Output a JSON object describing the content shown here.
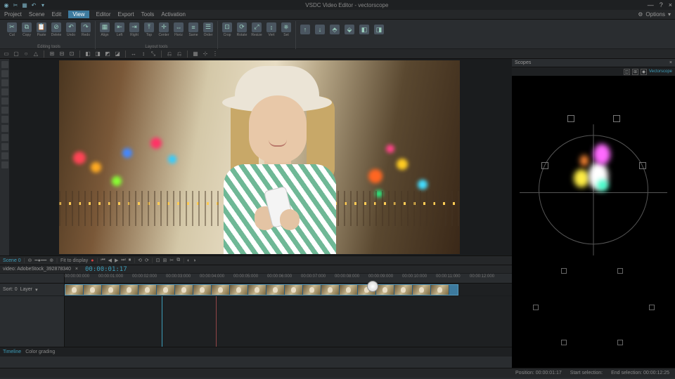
{
  "app": {
    "title": "VSDC Video Editor - vectorscope"
  },
  "window": {
    "min": "—",
    "max": "□",
    "close": "×",
    "help": "?"
  },
  "menu": {
    "items": [
      "Project",
      "Scene",
      "Edit",
      "View",
      "Editor",
      "Export",
      "Tools",
      "Activation"
    ],
    "activeIndex": 3,
    "options": "Options"
  },
  "ribbon": {
    "group1": {
      "label": "Editing tools",
      "items": [
        {
          "lbl": "Cut",
          "g": "✂"
        },
        {
          "lbl": "Copy",
          "g": "⧉"
        },
        {
          "lbl": "Paste",
          "g": "📋"
        },
        {
          "lbl": "Delete",
          "g": "⊘"
        },
        {
          "lbl": "Undo",
          "g": "↶"
        },
        {
          "lbl": "Redo",
          "g": "↷"
        }
      ]
    },
    "group2": {
      "label": "Layout tools",
      "items": [
        {
          "lbl": "Align",
          "g": "▦"
        },
        {
          "lbl": "Left",
          "g": "⇤"
        },
        {
          "lbl": "Right",
          "g": "⇥"
        },
        {
          "lbl": "Top",
          "g": "⤒"
        },
        {
          "lbl": "Center",
          "g": "✛"
        },
        {
          "lbl": "Horiz",
          "g": "⇔"
        },
        {
          "lbl": "Same",
          "g": "≡"
        },
        {
          "lbl": "Order",
          "g": "☰"
        }
      ]
    },
    "group3": {
      "label": "",
      "items": [
        {
          "lbl": "Crop",
          "g": "⊡"
        },
        {
          "lbl": "Rotate",
          "g": "⟳"
        },
        {
          "lbl": "Resize",
          "g": "⤢"
        },
        {
          "lbl": "Vert",
          "g": "↕"
        },
        {
          "lbl": "Set",
          "g": "⎈"
        }
      ]
    },
    "group4": {
      "label": "",
      "items": [
        {
          "lbl": "",
          "g": "↑"
        },
        {
          "lbl": "",
          "g": "↓"
        },
        {
          "lbl": "",
          "g": "⬘"
        },
        {
          "lbl": "",
          "g": "⬙"
        },
        {
          "lbl": "",
          "g": "◧"
        },
        {
          "lbl": "",
          "g": "◨"
        }
      ]
    }
  },
  "scopes": {
    "title": "Scopes",
    "mode": "Vectorscope"
  },
  "playbar": {
    "scene": "Scene 0",
    "fit": "Fit to display",
    "rec": "●",
    "controls": [
      "⏮",
      "◀",
      "▶",
      "⏭",
      "⏹",
      "⟲",
      "⟳"
    ]
  },
  "timeline": {
    "tab": "video: AdobeStock_392878340",
    "timecode": "00:00:01:17",
    "ticks": [
      "00:00:00:000",
      "00:00:01:000",
      "00:00:02:000",
      "00:00:03:000",
      "00:00:04:000",
      "00:00:05:000",
      "00:00:06:000",
      "00:00:07:000",
      "00:00:08:000",
      "00:00:09:000",
      "00:00:10:000",
      "00:00:11:000",
      "00:00:12:000"
    ],
    "track0": {
      "name": "Sort: 0",
      "layer": "Layer"
    },
    "clip": {
      "start": 0,
      "thumbs": 21
    },
    "tabs": [
      "Timeline",
      "Color grading"
    ],
    "activeTab": 0
  },
  "status": {
    "pos": "Position: 00:00:01:17",
    "start": "Start selection:",
    "end": "End selection: 00:00:12:25"
  }
}
